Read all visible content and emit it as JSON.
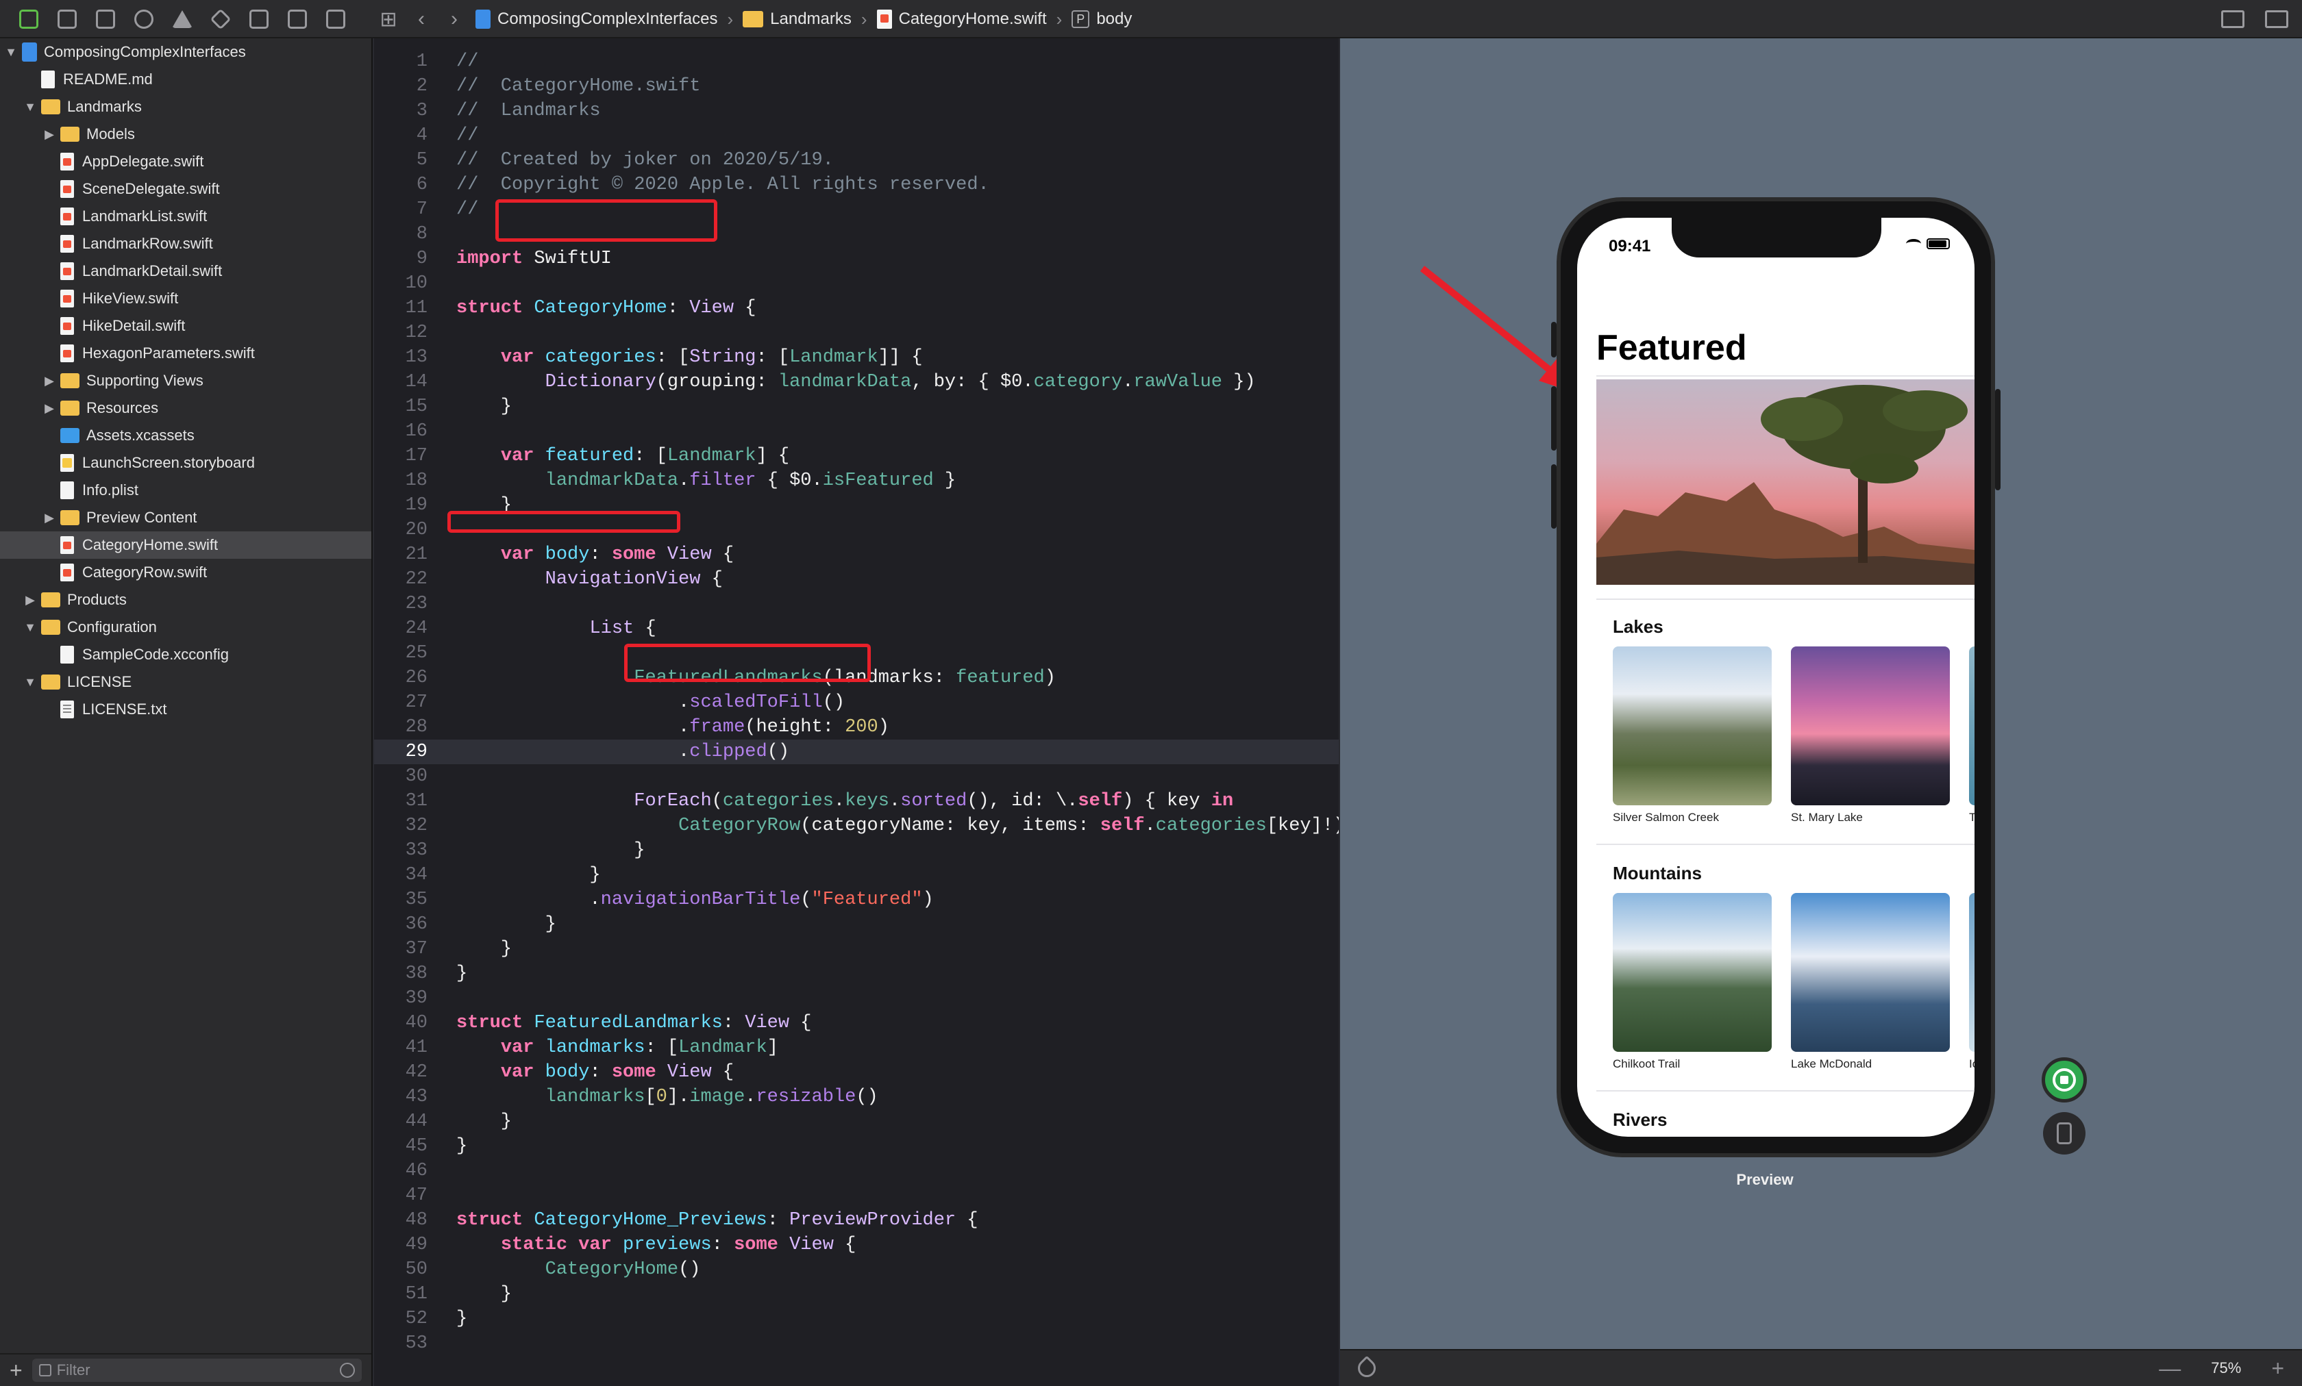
{
  "toolbar": {
    "breadcrumbs": [
      "ComposingComplexInterfaces",
      "Landmarks",
      "CategoryHome.swift",
      "body"
    ],
    "back_glyph": "‹",
    "forward_glyph": "›",
    "icons": [
      "folder-icon",
      "source-control-icon",
      "symbol-icon",
      "search-icon",
      "warning-icon",
      "test-icon",
      "debug-icon",
      "breakpoint-icon",
      "report-icon"
    ]
  },
  "sidebar": {
    "items": [
      {
        "label": "ComposingComplexInterfaces",
        "depth": 0,
        "kind": "project",
        "disclosure": "open"
      },
      {
        "label": "README.md",
        "depth": 1,
        "kind": "doc"
      },
      {
        "label": "Landmarks",
        "depth": 1,
        "kind": "folder",
        "disclosure": "open"
      },
      {
        "label": "Models",
        "depth": 2,
        "kind": "folder",
        "disclosure": "closed"
      },
      {
        "label": "AppDelegate.swift",
        "depth": 2,
        "kind": "swift"
      },
      {
        "label": "SceneDelegate.swift",
        "depth": 2,
        "kind": "swift"
      },
      {
        "label": "LandmarkList.swift",
        "depth": 2,
        "kind": "swift"
      },
      {
        "label": "LandmarkRow.swift",
        "depth": 2,
        "kind": "swift"
      },
      {
        "label": "LandmarkDetail.swift",
        "depth": 2,
        "kind": "swift"
      },
      {
        "label": "HikeView.swift",
        "depth": 2,
        "kind": "swift"
      },
      {
        "label": "HikeDetail.swift",
        "depth": 2,
        "kind": "swift"
      },
      {
        "label": "HexagonParameters.swift",
        "depth": 2,
        "kind": "swift"
      },
      {
        "label": "Supporting Views",
        "depth": 2,
        "kind": "folder",
        "disclosure": "closed"
      },
      {
        "label": "Resources",
        "depth": 2,
        "kind": "folder",
        "disclosure": "closed"
      },
      {
        "label": "Assets.xcassets",
        "depth": 2,
        "kind": "assets"
      },
      {
        "label": "LaunchScreen.storyboard",
        "depth": 2,
        "kind": "storyboard"
      },
      {
        "label": "Info.plist",
        "depth": 2,
        "kind": "doc"
      },
      {
        "label": "Preview Content",
        "depth": 2,
        "kind": "folder",
        "disclosure": "closed"
      },
      {
        "label": "CategoryHome.swift",
        "depth": 2,
        "kind": "swift",
        "selected": true
      },
      {
        "label": "CategoryRow.swift",
        "depth": 2,
        "kind": "swift"
      },
      {
        "label": "Products",
        "depth": 1,
        "kind": "folder",
        "disclosure": "closed"
      },
      {
        "label": "Configuration",
        "depth": 1,
        "kind": "folder",
        "disclosure": "open"
      },
      {
        "label": "SampleCode.xcconfig",
        "depth": 2,
        "kind": "doc"
      },
      {
        "label": "LICENSE",
        "depth": 1,
        "kind": "folder",
        "disclosure": "open"
      },
      {
        "label": "LICENSE.txt",
        "depth": 2,
        "kind": "text"
      }
    ],
    "filter_placeholder": "Filter",
    "add_glyph": "+"
  },
  "editor": {
    "current_line": 29,
    "lines": [
      [
        [
          "c",
          "//"
        ]
      ],
      [
        [
          "c",
          "//  CategoryHome.swift"
        ]
      ],
      [
        [
          "c",
          "//  Landmarks"
        ]
      ],
      [
        [
          "c",
          "//"
        ]
      ],
      [
        [
          "c",
          "//  Created by joker on 2020/5/19."
        ]
      ],
      [
        [
          "c",
          "//  Copyright © 2020 Apple. All rights reserved."
        ]
      ],
      [
        [
          "c",
          "//"
        ]
      ],
      [],
      [
        [
          "k",
          "import"
        ],
        [
          "p",
          " SwiftUI"
        ]
      ],
      [],
      [
        [
          "k",
          "struct"
        ],
        [
          "p",
          " "
        ],
        [
          "d",
          "CategoryHome"
        ],
        [
          "p",
          ": "
        ],
        [
          "t",
          "View"
        ],
        [
          "p",
          " {"
        ]
      ],
      [],
      [
        [
          "p",
          "    "
        ],
        [
          "k",
          "var"
        ],
        [
          "p",
          " "
        ],
        [
          "d",
          "categories"
        ],
        [
          "p",
          ": ["
        ],
        [
          "t",
          "String"
        ],
        [
          "p",
          ": ["
        ],
        [
          "i",
          "Landmark"
        ],
        [
          "p",
          "]] {"
        ]
      ],
      [
        [
          "p",
          "        "
        ],
        [
          "t",
          "Dictionary"
        ],
        [
          "p",
          "(grouping: "
        ],
        [
          "i",
          "landmarkData"
        ],
        [
          "p",
          ", by: { $0."
        ],
        [
          "i",
          "category"
        ],
        [
          "p",
          "."
        ],
        [
          "i",
          "rawValue"
        ],
        [
          "p",
          " })"
        ]
      ],
      [
        [
          "p",
          "    }"
        ]
      ],
      [],
      [
        [
          "p",
          "    "
        ],
        [
          "k",
          "var"
        ],
        [
          "p",
          " "
        ],
        [
          "d",
          "featured"
        ],
        [
          "p",
          ": ["
        ],
        [
          "i",
          "Landmark"
        ],
        [
          "p",
          "] {"
        ]
      ],
      [
        [
          "p",
          "        "
        ],
        [
          "i",
          "landmarkData"
        ],
        [
          "p",
          "."
        ],
        [
          "f",
          "filter"
        ],
        [
          "p",
          " { $0."
        ],
        [
          "i",
          "isFeatured"
        ],
        [
          "p",
          " }"
        ]
      ],
      [
        [
          "p",
          "    }"
        ]
      ],
      [],
      [
        [
          "p",
          "    "
        ],
        [
          "k",
          "var"
        ],
        [
          "p",
          " "
        ],
        [
          "d",
          "body"
        ],
        [
          "p",
          ": "
        ],
        [
          "k",
          "some"
        ],
        [
          "p",
          " "
        ],
        [
          "t",
          "View"
        ],
        [
          "p",
          " {"
        ]
      ],
      [
        [
          "p",
          "        "
        ],
        [
          "t",
          "NavigationView"
        ],
        [
          "p",
          " {"
        ]
      ],
      [],
      [
        [
          "p",
          "            "
        ],
        [
          "t",
          "List"
        ],
        [
          "p",
          " {"
        ]
      ],
      [],
      [
        [
          "p",
          "                "
        ],
        [
          "i",
          "FeaturedLandmarks"
        ],
        [
          "p",
          "(landmarks: "
        ],
        [
          "i",
          "featured"
        ],
        [
          "p",
          ")"
        ]
      ],
      [
        [
          "p",
          "                    ."
        ],
        [
          "f",
          "scaledToFill"
        ],
        [
          "p",
          "()"
        ]
      ],
      [
        [
          "p",
          "                    ."
        ],
        [
          "f",
          "frame"
        ],
        [
          "p",
          "(height: "
        ],
        [
          "n",
          "200"
        ],
        [
          "p",
          ")"
        ]
      ],
      [
        [
          "p",
          "                    ."
        ],
        [
          "f",
          "clipped"
        ],
        [
          "p",
          "()"
        ]
      ],
      [],
      [
        [
          "p",
          "                "
        ],
        [
          "t",
          "ForEach"
        ],
        [
          "p",
          "("
        ],
        [
          "i",
          "categories"
        ],
        [
          "p",
          "."
        ],
        [
          "i",
          "keys"
        ],
        [
          "p",
          "."
        ],
        [
          "f",
          "sorted"
        ],
        [
          "p",
          "(), id: \\."
        ],
        [
          "k",
          "self"
        ],
        [
          "p",
          ") { key "
        ],
        [
          "k",
          "in"
        ]
      ],
      [
        [
          "p",
          "                    "
        ],
        [
          "i",
          "CategoryRow"
        ],
        [
          "p",
          "(categoryName: key, items: "
        ],
        [
          "k",
          "self"
        ],
        [
          "p",
          "."
        ],
        [
          "i",
          "categories"
        ],
        [
          "p",
          "[key]!)"
        ]
      ],
      [
        [
          "p",
          "                }"
        ]
      ],
      [
        [
          "p",
          "            }"
        ]
      ],
      [
        [
          "p",
          "            ."
        ],
        [
          "f",
          "navigationBarTitle"
        ],
        [
          "p",
          "("
        ],
        [
          "s",
          "\"Featured\""
        ],
        [
          "p",
          ")"
        ]
      ],
      [
        [
          "p",
          "        }"
        ]
      ],
      [
        [
          "p",
          "    }"
        ]
      ],
      [
        [
          "p",
          "}"
        ]
      ],
      [],
      [
        [
          "k",
          "struct"
        ],
        [
          "p",
          " "
        ],
        [
          "d",
          "FeaturedLandmarks"
        ],
        [
          "p",
          ": "
        ],
        [
          "t",
          "View"
        ],
        [
          "p",
          " {"
        ]
      ],
      [
        [
          "p",
          "    "
        ],
        [
          "k",
          "var"
        ],
        [
          "p",
          " "
        ],
        [
          "d",
          "landmarks"
        ],
        [
          "p",
          ": ["
        ],
        [
          "i",
          "Landmark"
        ],
        [
          "p",
          "]"
        ]
      ],
      [
        [
          "p",
          "    "
        ],
        [
          "k",
          "var"
        ],
        [
          "p",
          " "
        ],
        [
          "d",
          "body"
        ],
        [
          "p",
          ": "
        ],
        [
          "k",
          "some"
        ],
        [
          "p",
          " "
        ],
        [
          "t",
          "View"
        ],
        [
          "p",
          " {"
        ]
      ],
      [
        [
          "p",
          "        "
        ],
        [
          "i",
          "landmarks"
        ],
        [
          "p",
          "["
        ],
        [
          "n",
          "0"
        ],
        [
          "p",
          "]."
        ],
        [
          "i",
          "image"
        ],
        [
          "p",
          "."
        ],
        [
          "f",
          "resizable"
        ],
        [
          "p",
          "()"
        ]
      ],
      [
        [
          "p",
          "    }"
        ]
      ],
      [
        [
          "p",
          "}"
        ]
      ],
      [],
      [],
      [
        [
          "k",
          "struct"
        ],
        [
          "p",
          " "
        ],
        [
          "d",
          "CategoryHome_Previews"
        ],
        [
          "p",
          ": "
        ],
        [
          "t",
          "PreviewProvider"
        ],
        [
          "p",
          " {"
        ]
      ],
      [
        [
          "p",
          "    "
        ],
        [
          "k",
          "static"
        ],
        [
          "p",
          " "
        ],
        [
          "k",
          "var"
        ],
        [
          "p",
          " "
        ],
        [
          "d",
          "previews"
        ],
        [
          "p",
          ": "
        ],
        [
          "k",
          "some"
        ],
        [
          "p",
          " "
        ],
        [
          "t",
          "View"
        ],
        [
          "p",
          " {"
        ]
      ],
      [
        [
          "p",
          "        "
        ],
        [
          "i",
          "CategoryHome"
        ],
        [
          "p",
          "()"
        ]
      ],
      [
        [
          "p",
          "    }"
        ]
      ],
      [
        [
          "p",
          "}"
        ]
      ],
      []
    ]
  },
  "preview": {
    "status_time": "09:41",
    "nav_title": "Featured",
    "categories": [
      {
        "name": "Lakes",
        "items": [
          "Silver Salmon Creek",
          "St. Mary Lake",
          "Twi"
        ]
      },
      {
        "name": "Mountains",
        "items": [
          "Chilkoot Trail",
          "Lake McDonald",
          "Icy"
        ]
      },
      {
        "name": "Rivers",
        "items": [
          "",
          "",
          ""
        ]
      }
    ],
    "label": "Preview",
    "zoom": "75%",
    "zoom_out_glyph": "—",
    "zoom_in_glyph": "+"
  },
  "colors": {
    "accent_red": "#e8202a",
    "live_green": "#2fa84f",
    "selection": "#464649"
  }
}
